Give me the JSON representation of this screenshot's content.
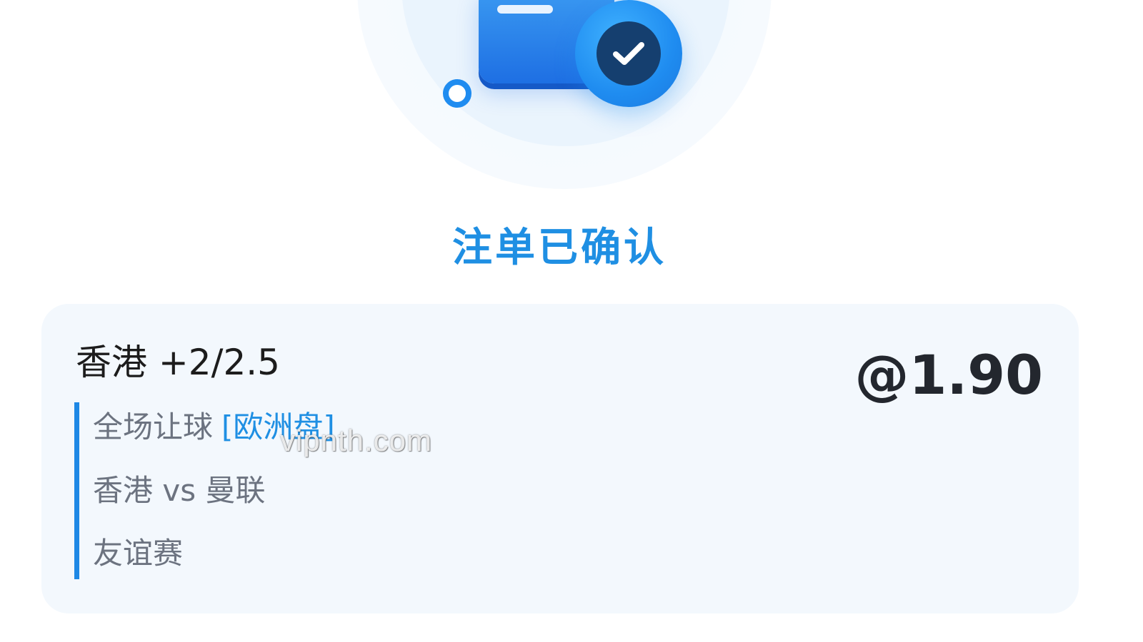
{
  "header": {
    "title": "注单已确认",
    "icon": "wallet-check-icon",
    "accent_color": "#1f8fe3"
  },
  "bet": {
    "selection": "香港 +2/2.5",
    "odds": "@1.90",
    "market": "全场让球",
    "market_tag": "[欧洲盘]",
    "match": "香港 vs 曼联",
    "league": "友谊赛"
  },
  "watermark": "vipnth.com"
}
